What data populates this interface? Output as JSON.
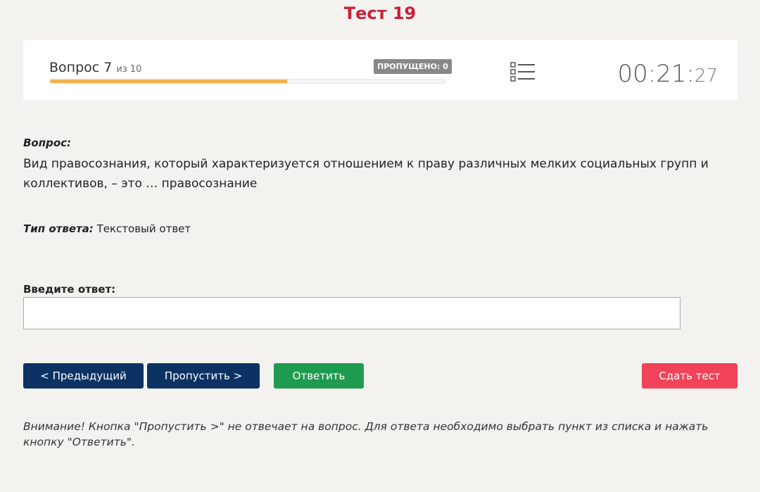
{
  "header": {
    "title": "Тест 19"
  },
  "status": {
    "question_word": "Вопрос 7",
    "of_text": "из 10",
    "skipped_label": "ПРОПУЩЕНО: 0",
    "progress_fraction": 0.6,
    "timer_main": "00:21:",
    "timer_seconds": "27",
    "progress_color": "#f2b24f"
  },
  "question": {
    "label": "Вопрос:",
    "text": "Вид правосознания, который характеризуется отношением к праву различных мелких социальных групп и коллективов, – это … правосознание"
  },
  "answer_type": {
    "label": "Тип ответа:",
    "value": "Текстовый ответ"
  },
  "answer_input": {
    "label": "Введите ответ:",
    "value": "",
    "placeholder": ""
  },
  "buttons": {
    "prev": "< Предыдущий",
    "skip": "Пропустить >",
    "answer": "Ответить",
    "finish": "Сдать тест"
  },
  "colors": {
    "title": "#c8203a",
    "nav_button": "#0c3264",
    "answer_button": "#1f9b50",
    "finish_button": "#f0435a"
  },
  "icons": {
    "question_list": "list-icon"
  },
  "warning": {
    "text": "Внимание! Кнопка \"Пропустить >\" не отвечает на вопрос. Для ответа необходимо выбрать пункт из списка и нажать кнопку \"Ответить\"."
  }
}
